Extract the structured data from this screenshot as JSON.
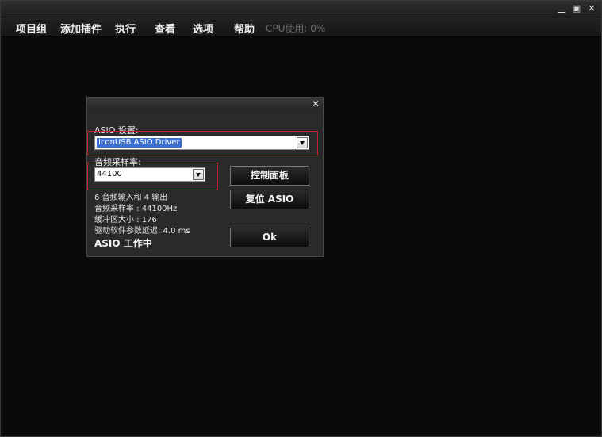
{
  "window": {
    "controls": {
      "minimize_icon": "minimize-icon",
      "maximize_icon": "maximize-icon",
      "close_icon": "close-icon"
    }
  },
  "menu": {
    "items": [
      "项目组",
      "添加插件",
      "执行",
      "查看",
      "选项",
      "帮助"
    ],
    "cpu_label": "CPU使用: 0%"
  },
  "dialog": {
    "close_glyph": "✕",
    "asio_label": "ASIO 设置:",
    "asio_driver": "IconUSB ASIO Driver",
    "sample_rate_label": "音频采样率:",
    "sample_rate": "44100",
    "control_panel_button": "控制面板",
    "reset_asio_button": "复位 ASIO",
    "ok_button": "Ok",
    "info": {
      "io": "6 音频输入和 4 输出",
      "rate": "音频采样率 : 44100Hz",
      "buffer": "缓冲区大小 : 176",
      "latency": "驱动软件参数延迟: 4.0 ms"
    },
    "status": "ASIO 工作中",
    "highlight_color": "#c0202a"
  }
}
